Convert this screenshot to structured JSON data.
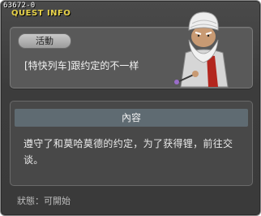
{
  "window": {
    "quest_id": "63672-0",
    "title": "QUEST INFO",
    "accent_color": "#e8d34a"
  },
  "quest": {
    "type_label": "活動",
    "name": "[特快列车]跟约定的不一样"
  },
  "content": {
    "header": "內容",
    "text": "遵守了和莫哈莫德的约定，为了获得锂，前往交谈。"
  },
  "status": {
    "text": "狀態：可開始"
  },
  "icons": {
    "npc": "old-man-with-turban-and-cane-icon"
  }
}
